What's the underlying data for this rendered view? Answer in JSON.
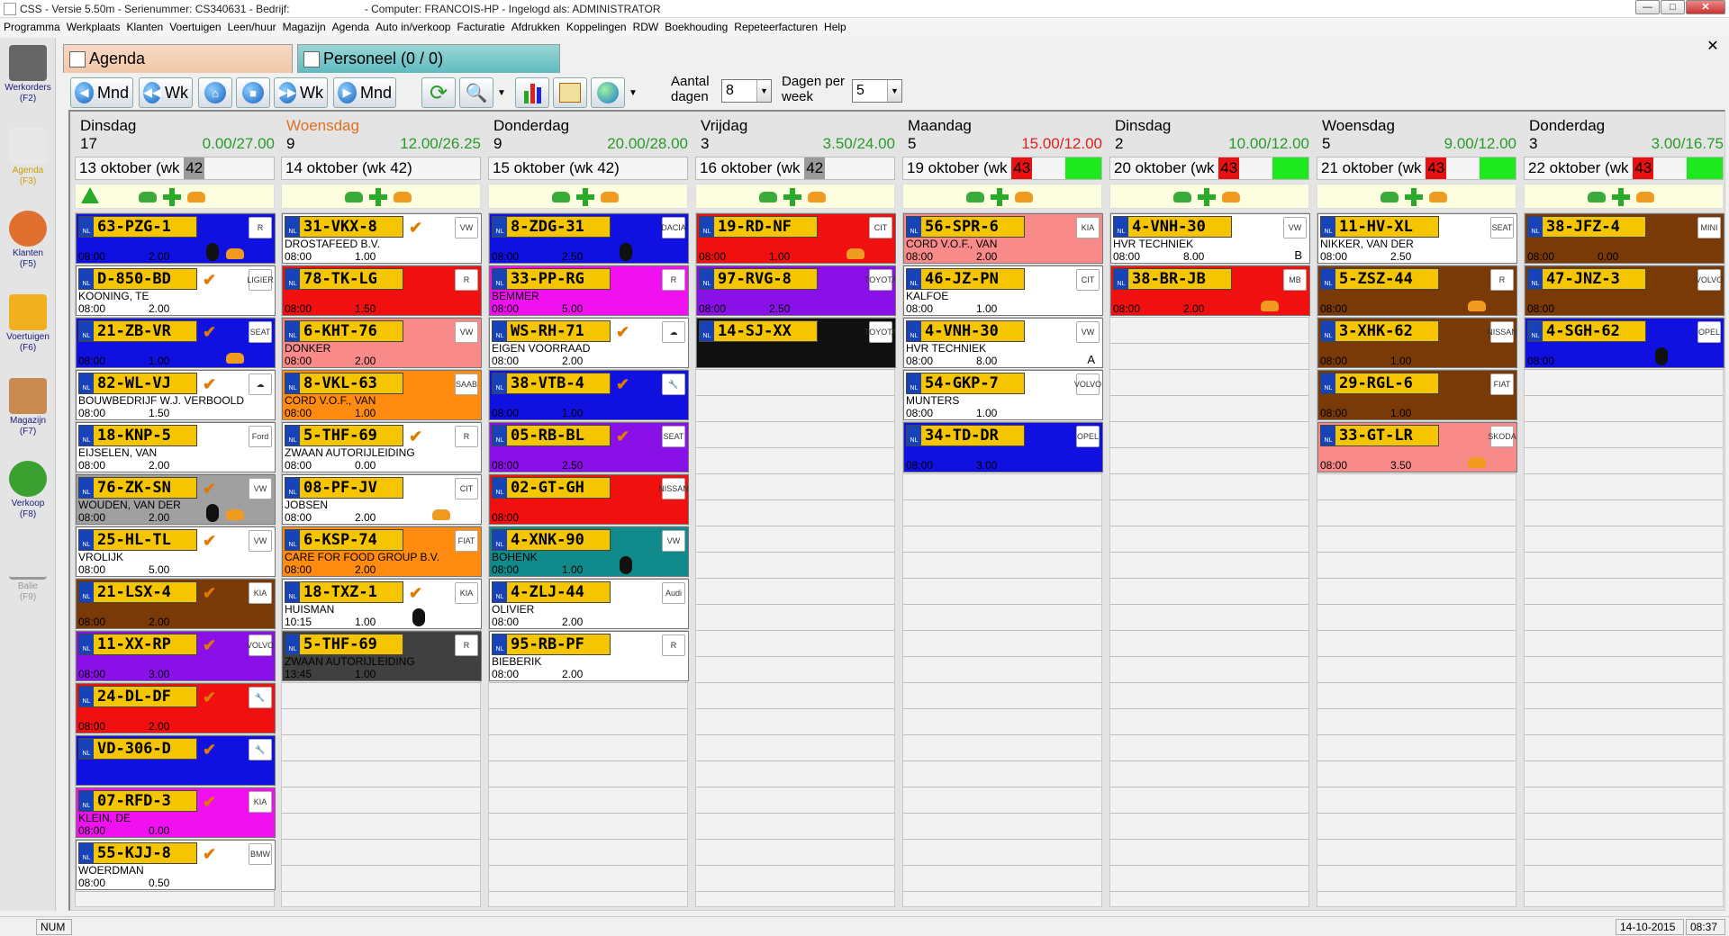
{
  "window": {
    "title": "CSS - Versie 5.50m - Serienummer: CS340631 - Bedrijf:                         - Computer: FRANCOIS-HP - Ingelogd als: ADMINISTRATOR"
  },
  "menu": [
    "Programma",
    "Werkplaats",
    "Klanten",
    "Voertuigen",
    "Leen/huur",
    "Magazijn",
    "Agenda",
    "Auto in/verkoop",
    "Facturatie",
    "Afdrukken",
    "Koppelingen",
    "RDW",
    "Boekhouding",
    "Repeteerfacturen",
    "Help"
  ],
  "nav": [
    {
      "label": "Werkorders",
      "key": "(F2)",
      "icon": "hammer-icon"
    },
    {
      "label": "Agenda",
      "key": "(F3)",
      "icon": "calendar-icon"
    },
    {
      "label": "Klanten",
      "key": "(F5)",
      "icon": "people-icon"
    },
    {
      "label": "Voertuigen",
      "key": "(F6)",
      "icon": "car-icon"
    },
    {
      "label": "Magazijn",
      "key": "(F7)",
      "icon": "box-icon"
    },
    {
      "label": "Verkoop",
      "key": "(F8)",
      "icon": "sale-icon"
    },
    {
      "label": "Balie",
      "key": "(F9)",
      "icon": "wrench-icon"
    }
  ],
  "tabs": {
    "agenda": "Agenda",
    "personeel": "Personeel (0 / 0)"
  },
  "toolbar": {
    "mnd_back": "Mnd",
    "wk_back": "Wk",
    "wk_fwd": "Wk",
    "mnd_fwd": "Mnd",
    "aantal_dagen_label": "Aantal dagen",
    "aantal_dagen_value": "8",
    "dagen_per_week_label": "Dagen per week",
    "dagen_per_week_value": "5"
  },
  "days": [
    {
      "name": "Dinsdag",
      "num": "17",
      "hours": "0.00/27.00",
      "over": false,
      "date": "13 oktober (wk ",
      "wk": "42",
      "wk_red": false,
      "green": false,
      "cards": [
        {
          "plate": "63-PZG-1",
          "color": "#1010e0",
          "name": "",
          "time": "08:00",
          "hours": "2.00",
          "check": false,
          "badge": "R",
          "tyre": true,
          "car": true
        },
        {
          "plate": "D-850-BD",
          "color": "#ffffff",
          "name": "KOONING, TE",
          "time": "08:00",
          "hours": "2.00",
          "check": true,
          "badge": "LIGIER",
          "tyre": false,
          "car": false
        },
        {
          "plate": "21-ZB-VR",
          "color": "#1010e0",
          "name": "",
          "time": "08:00",
          "hours": "1.00",
          "check": true,
          "badge": "SEAT",
          "tyre": false,
          "car": true
        },
        {
          "plate": "82-WL-VJ",
          "color": "#ffffff",
          "name": "BOUWBEDRIJF W.J. VERBOOLD",
          "time": "08:00",
          "hours": "1.50",
          "check": true,
          "badge": "☁",
          "tyre": false,
          "car": false
        },
        {
          "plate": "18-KNP-5",
          "color": "#ffffff",
          "name": "EIJSELEN, VAN",
          "time": "08:00",
          "hours": "2.00",
          "check": false,
          "badge": "Ford",
          "tyre": false,
          "car": false
        },
        {
          "plate": "76-ZK-SN",
          "color": "#a0a0a0",
          "name": "WOUDEN, VAN DER",
          "time": "08:00",
          "hours": "2.00",
          "check": true,
          "badge": "VW",
          "tyre": true,
          "car": true
        },
        {
          "plate": "25-HL-TL",
          "color": "#ffffff",
          "name": "VROLIJK",
          "time": "08:00",
          "hours": "5.00",
          "check": true,
          "badge": "VW",
          "tyre": false,
          "car": false
        },
        {
          "plate": "21-LSX-4",
          "color": "#7a3a08",
          "name": "",
          "time": "08:00",
          "hours": "2.00",
          "check": true,
          "badge": "KIA",
          "tyre": false,
          "car": false
        },
        {
          "plate": "11-XX-RP",
          "color": "#8a10e8",
          "name": "",
          "time": "08:00",
          "hours": "3.00",
          "check": true,
          "badge": "VOLVO",
          "tyre": false,
          "car": false
        },
        {
          "plate": "24-DL-DF",
          "color": "#f01010",
          "name": "",
          "time": "08:00",
          "hours": "2.00",
          "check": true,
          "badge": "🔧",
          "tyre": false,
          "car": false
        },
        {
          "plate": "VD-306-D",
          "color": "#1010e0",
          "name": "",
          "time": "",
          "hours": "",
          "check": true,
          "badge": "🔧",
          "tyre": false,
          "car": false
        },
        {
          "plate": "07-RFD-3",
          "color": "#f010f0",
          "name": "KLEIN, DE",
          "time": "08:00",
          "hours": "0.00",
          "check": true,
          "badge": "KIA",
          "tyre": false,
          "car": false
        },
        {
          "plate": "55-KJJ-8",
          "color": "#ffffff",
          "name": "WOERDMAN",
          "time": "08:00",
          "hours": "0.50",
          "check": true,
          "badge": "BMW",
          "tyre": false,
          "car": false
        }
      ]
    },
    {
      "name": "Woensdag",
      "num": "9",
      "hours": "12.00/26.25",
      "over": false,
      "today": true,
      "date": "14 oktober (wk 42)",
      "wk": "",
      "wk_red": false,
      "green": false,
      "cards": [
        {
          "plate": "31-VKX-8",
          "color": "#ffffff",
          "name": "DROSTAFEED B.V.",
          "time": "08:00",
          "hours": "1.00",
          "check": true,
          "badge": "VW",
          "tyre": false,
          "car": false
        },
        {
          "plate": "78-TK-LG",
          "color": "#f01010",
          "name": "",
          "time": "08:00",
          "hours": "1.50",
          "check": false,
          "badge": "R",
          "tyre": false,
          "car": false
        },
        {
          "plate": "6-KHT-76",
          "color": "#f88a8a",
          "name": "DONKER",
          "time": "08:00",
          "hours": "2.00",
          "check": false,
          "badge": "VW",
          "tyre": false,
          "car": false
        },
        {
          "plate": "8-VKL-63",
          "color": "#ff8c10",
          "name": "CORD V.O.F., VAN",
          "time": "08:00",
          "hours": "1.00",
          "check": false,
          "badge": "SAAB",
          "tyre": false,
          "car": false
        },
        {
          "plate": "5-THF-69",
          "color": "#ffffff",
          "name": "ZWAAN AUTORIJLEIDING",
          "time": "08:00",
          "hours": "0.00",
          "check": true,
          "badge": "R",
          "tyre": false,
          "car": false
        },
        {
          "plate": "08-PF-JV",
          "color": "#ffffff",
          "name": "JOBSEN",
          "time": "08:00",
          "hours": "2.00",
          "check": false,
          "badge": "CIT",
          "tyre": false,
          "car": true
        },
        {
          "plate": "6-KSP-74",
          "color": "#ff8c10",
          "name": "CARE FOR FOOD GROUP B.V.",
          "time": "08:00",
          "hours": "2.00",
          "check": false,
          "badge": "FIAT",
          "tyre": false,
          "car": false
        },
        {
          "plate": "18-TXZ-1",
          "color": "#ffffff",
          "name": "HUISMAN",
          "time": "10:15",
          "hours": "1.00",
          "check": true,
          "badge": "KIA",
          "tyre": true,
          "car": false
        },
        {
          "plate": "5-THF-69",
          "color": "#404040",
          "name": "ZWAAN AUTORIJLEIDING",
          "time": "13:45",
          "hours": "1.00",
          "check": false,
          "badge": "R",
          "tyre": false,
          "car": false
        }
      ]
    },
    {
      "name": "Donderdag",
      "num": "9",
      "hours": "20.00/28.00",
      "over": false,
      "date": "15 oktober (wk 42)",
      "wk": "",
      "wk_red": false,
      "green": false,
      "cards": [
        {
          "plate": "8-ZDG-31",
          "color": "#1010e0",
          "name": "",
          "time": "08:00",
          "hours": "2.50",
          "check": false,
          "badge": "DACIA",
          "tyre": true,
          "car": false
        },
        {
          "plate": "33-PP-RG",
          "color": "#f010f0",
          "name": "BEMMER",
          "time": "08:00",
          "hours": "5.00",
          "check": false,
          "badge": "R",
          "tyre": false,
          "car": false
        },
        {
          "plate": "WS-RH-71",
          "color": "#ffffff",
          "name": "EIGEN VOORRAAD",
          "time": "08:00",
          "hours": "2.00",
          "check": true,
          "badge": "☁",
          "tyre": false,
          "car": false
        },
        {
          "plate": "38-VTB-4",
          "color": "#1010e0",
          "name": "",
          "time": "08:00",
          "hours": "1.00",
          "check": true,
          "badge": "🔧",
          "tyre": false,
          "car": false
        },
        {
          "plate": "05-RB-BL",
          "color": "#8a10e8",
          "name": "",
          "time": "08:00",
          "hours": "2.50",
          "check": true,
          "badge": "SEAT",
          "tyre": false,
          "car": false
        },
        {
          "plate": "02-GT-GH",
          "color": "#f01010",
          "name": "",
          "time": "08:00",
          "hours": "",
          "check": false,
          "badge": "NISSAN",
          "tyre": false,
          "car": false
        },
        {
          "plate": "4-XNK-90",
          "color": "#108a8a",
          "name": "BOHENK",
          "time": "08:00",
          "hours": "1.00",
          "check": false,
          "badge": "VW",
          "tyre": true,
          "car": false
        },
        {
          "plate": "4-ZLJ-44",
          "color": "#ffffff",
          "name": "OLIVIER",
          "time": "08:00",
          "hours": "2.00",
          "check": false,
          "badge": "Audi",
          "tyre": false,
          "car": false
        },
        {
          "plate": "95-RB-PF",
          "color": "#ffffff",
          "name": "BIEBERIK",
          "time": "08:00",
          "hours": "2.00",
          "check": false,
          "badge": "R",
          "tyre": false,
          "car": false
        }
      ]
    },
    {
      "name": "Vrijdag",
      "num": "3",
      "hours": "3.50/24.00",
      "over": false,
      "date": "16 oktober (wk ",
      "wk": "42",
      "wk_red": false,
      "green": false,
      "cards": [
        {
          "plate": "19-RD-NF",
          "color": "#f01010",
          "name": "",
          "time": "08:00",
          "hours": "1.00",
          "check": false,
          "badge": "CIT",
          "tyre": false,
          "car": true
        },
        {
          "plate": "97-RVG-8",
          "color": "#8a10e8",
          "name": "",
          "time": "08:00",
          "hours": "2.50",
          "check": false,
          "badge": "TOYOTA",
          "tyre": false,
          "car": false
        },
        {
          "plate": "14-SJ-XX",
          "color": "#101010",
          "name": "",
          "time": "",
          "hours": "",
          "check": false,
          "badge": "TOYOTA",
          "tyre": false,
          "car": false
        }
      ]
    },
    {
      "name": "Maandag",
      "num": "5",
      "hours": "15.00/12.00",
      "over": true,
      "date": "19 oktober (wk ",
      "wk": "43",
      "wk_red": true,
      "green": true,
      "cards": [
        {
          "plate": "56-SPR-6",
          "color": "#f88a8a",
          "name": "CORD V.O.F., VAN",
          "time": "08:00",
          "hours": "2.00",
          "check": false,
          "badge": "KIA",
          "tyre": false,
          "car": false
        },
        {
          "plate": "46-JZ-PN",
          "color": "#ffffff",
          "name": "KALFOE",
          "time": "08:00",
          "hours": "1.00",
          "check": false,
          "badge": "CIT",
          "tyre": false,
          "car": false
        },
        {
          "plate": "4-VNH-30",
          "color": "#ffffff",
          "name": "HVR TECHNIEK",
          "time": "08:00",
          "hours": "8.00",
          "check": false,
          "badge": "VW",
          "letter": "A",
          "tyre": false,
          "car": false
        },
        {
          "plate": "54-GKP-7",
          "color": "#ffffff",
          "name": "MUNTERS",
          "time": "08:00",
          "hours": "1.00",
          "check": false,
          "badge": "VOLVO",
          "tyre": false,
          "car": false
        },
        {
          "plate": "34-TD-DR",
          "color": "#1010e0",
          "name": "",
          "time": "08:00",
          "hours": "3.00",
          "check": false,
          "badge": "OPEL",
          "tyre": false,
          "car": false
        }
      ]
    },
    {
      "name": "Dinsdag",
      "num": "2",
      "hours": "10.00/12.00",
      "over": false,
      "date": "20 oktober (wk ",
      "wk": "43",
      "wk_red": true,
      "green": true,
      "cards": [
        {
          "plate": "4-VNH-30",
          "color": "#ffffff",
          "name": "HVR TECHNIEK",
          "time": "08:00",
          "hours": "8.00",
          "check": false,
          "badge": "VW",
          "letter": "B",
          "tyre": false,
          "car": false
        },
        {
          "plate": "38-BR-JB",
          "color": "#f01010",
          "name": "",
          "time": "08:00",
          "hours": "2.00",
          "check": false,
          "badge": "MB",
          "tyre": false,
          "car": true
        }
      ]
    },
    {
      "name": "Woensdag",
      "num": "5",
      "hours": "9.00/12.00",
      "over": false,
      "date": "21 oktober (wk ",
      "wk": "43",
      "wk_red": true,
      "green": true,
      "cards": [
        {
          "plate": "11-HV-XL",
          "color": "#ffffff",
          "name": "NIKKER, VAN DER",
          "time": "08:00",
          "hours": "2.50",
          "check": false,
          "badge": "SEAT",
          "tyre": false,
          "car": false
        },
        {
          "plate": "5-ZSZ-44",
          "color": "#7a3a08",
          "name": "",
          "time": "08:00",
          "hours": "",
          "check": false,
          "badge": "R",
          "tyre": false,
          "car": true
        },
        {
          "plate": "3-XHK-62",
          "color": "#7a3a08",
          "name": "",
          "time": "08:00",
          "hours": "1.00",
          "check": false,
          "badge": "NISSAN",
          "tyre": false,
          "car": false
        },
        {
          "plate": "29-RGL-6",
          "color": "#7a3a08",
          "name": "",
          "time": "08:00",
          "hours": "1.00",
          "check": false,
          "badge": "FIAT",
          "tyre": false,
          "car": false
        },
        {
          "plate": "33-GT-LR",
          "color": "#f88a8a",
          "name": "",
          "time": "08:00",
          "hours": "3.50",
          "check": false,
          "badge": "SKODA",
          "tyre": false,
          "car": true
        }
      ]
    },
    {
      "name": "Donderdag",
      "num": "3",
      "hours": "3.00/16.75",
      "over": false,
      "date": "22 oktober (wk ",
      "wk": "43",
      "wk_red": true,
      "green": true,
      "cards": [
        {
          "plate": "38-JFZ-4",
          "color": "#7a3a08",
          "name": "",
          "time": "08:00",
          "hours": "0.00",
          "check": false,
          "badge": "MINI",
          "tyre": false,
          "car": false
        },
        {
          "plate": "47-JNZ-3",
          "color": "#7a3a08",
          "name": "",
          "time": "08:00",
          "hours": "",
          "check": false,
          "badge": "VOLVO",
          "tyre": false,
          "car": false
        },
        {
          "plate": "4-SGH-62",
          "color": "#1010e0",
          "name": "",
          "time": "08:00",
          "hours": "",
          "check": false,
          "badge": "OPEL",
          "tyre": true,
          "car": false
        }
      ]
    }
  ],
  "status": {
    "num": "NUM",
    "date": "14-10-2015",
    "time": "08:37"
  }
}
